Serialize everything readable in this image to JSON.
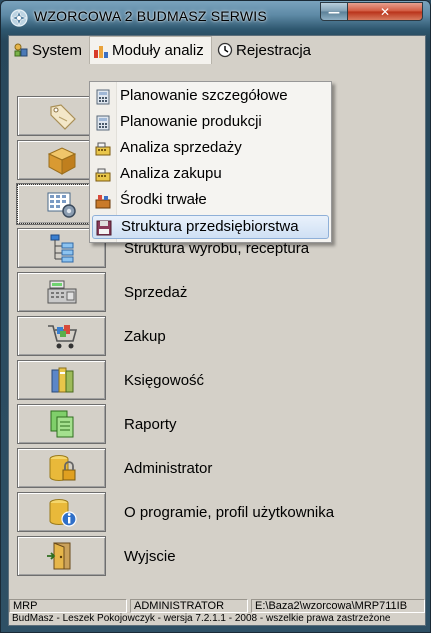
{
  "window": {
    "title": "WZORCOWA 2 BUDMASZ SERWIS",
    "close_glyph": "✕",
    "min_glyph": "—"
  },
  "menubar": {
    "items": [
      {
        "label": "System",
        "icon": "system-icon"
      },
      {
        "label": "Moduły analiz",
        "icon": "chart-icon",
        "active": true
      },
      {
        "label": "Rejestracja",
        "icon": "clock-icon"
      }
    ]
  },
  "dropdown": {
    "items": [
      {
        "label": "Planowanie szczegółowe",
        "icon": "calculator-icon"
      },
      {
        "label": "Planowanie produkcji",
        "icon": "calculator-icon"
      },
      {
        "label": "Analiza sprzedaży",
        "icon": "register-icon"
      },
      {
        "label": "Analiza zakupu",
        "icon": "register-icon"
      },
      {
        "label": "Środki trwałe",
        "icon": "tools-icon"
      },
      {
        "label": "Struktura przedsiębiorstwa",
        "icon": "floppy-icon",
        "hover": true
      }
    ]
  },
  "buttons": [
    {
      "label": "",
      "icon": "price-tag-icon"
    },
    {
      "label": "",
      "icon": "package-box-icon"
    },
    {
      "label": "",
      "icon": "grid-gear-icon",
      "selected": true
    },
    {
      "label": "Struktura wyrobu, receptura",
      "icon": "tree-structure-icon"
    },
    {
      "label": "Sprzedaż",
      "icon": "cash-register-icon"
    },
    {
      "label": "Zakup",
      "icon": "shopping-cart-icon"
    },
    {
      "label": "Księgowość",
      "icon": "books-icon"
    },
    {
      "label": "Raporty",
      "icon": "reports-icon"
    },
    {
      "label": "Administrator",
      "icon": "database-lock-icon"
    },
    {
      "label": "O programie, profil użytkownika",
      "icon": "database-info-icon"
    },
    {
      "label": "Wyjscie",
      "icon": "exit-door-icon"
    }
  ],
  "status": {
    "module": "MRP",
    "user": "ADMINISTRATOR",
    "path": "E:\\Baza2\\wzorcowa\\MRP711IB",
    "footer": "BudMasz - Leszek Pokojowczyk - wersja 7.2.1.1 - 2008 - wszelkie prawa zastrzeżone"
  },
  "colors": {
    "title_bar": "#2f5870",
    "client_bg": "#d4d0c8",
    "menu_hover": "#cfe0f4",
    "close_button": "#c8462b"
  }
}
